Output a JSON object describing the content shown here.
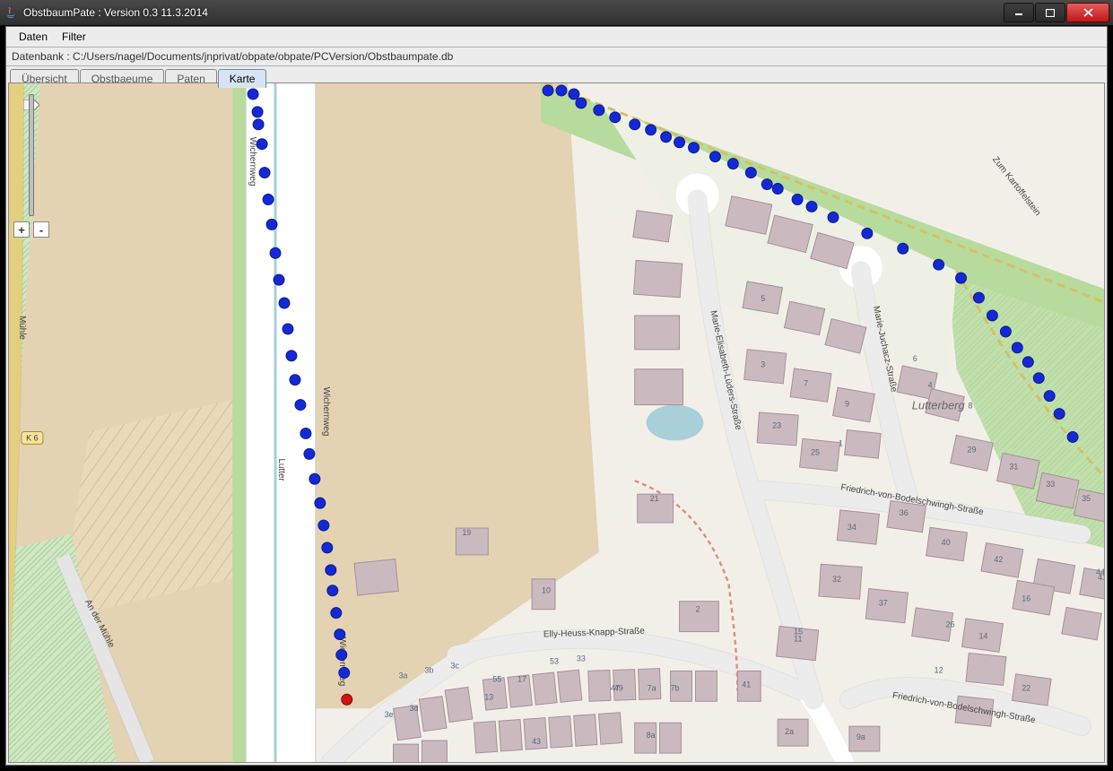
{
  "window": {
    "title": "ObstbaumPate : Version 0.3 11.3.2014"
  },
  "menubar": {
    "items": [
      "Daten",
      "Filter"
    ]
  },
  "infobar": {
    "text": "Datenbank : C:/Users/nagel/Documents/jnprivat/obpate/obpate/PCVersion/Obstbaumpate.db"
  },
  "tabs": {
    "items": [
      {
        "label": "Übersicht",
        "active": false
      },
      {
        "label": "Obstbaeume",
        "active": false
      },
      {
        "label": "Paten",
        "active": false
      },
      {
        "label": "Karte",
        "active": true
      }
    ]
  },
  "zoom": {
    "plus": "+",
    "minus": "-"
  },
  "map": {
    "place": "Lutterberg",
    "highway_ref": "K 6",
    "streets": {
      "wichernweg": "Wichernweg",
      "lutter": "Lutter",
      "an_der_muehle": "An der Mühle",
      "k_muehle": "Mühle",
      "marie_luders": "Marie-Elisabeth-Lüders-Straße",
      "marie_juchacz": "Marie-Juchacz-Straße",
      "bodelschwingh": "Friedrich-von-Bodelschwingh-Straße",
      "elly_heuss": "Elly-Heuss-Knapp-Straße",
      "zum_kartoffelstein": "Zum Kartoffelstein"
    },
    "house_numbers": [
      "1",
      "2",
      "2a",
      "3",
      "3a",
      "3b",
      "3c",
      "3d",
      "3e",
      "4",
      "5",
      "6",
      "7",
      "7a",
      "7b",
      "8",
      "8a",
      "9",
      "9a",
      "10",
      "11",
      "12",
      "13",
      "14",
      "15",
      "16",
      "17",
      "19",
      "21",
      "22",
      "23",
      "25",
      "26",
      "29",
      "31",
      "32",
      "33",
      "34",
      "35",
      "36",
      "37",
      "40",
      "41",
      "42",
      "43",
      "44",
      "47",
      "49",
      "53",
      "55"
    ],
    "markers_blue_count": 58,
    "markers_red_count": 1
  }
}
